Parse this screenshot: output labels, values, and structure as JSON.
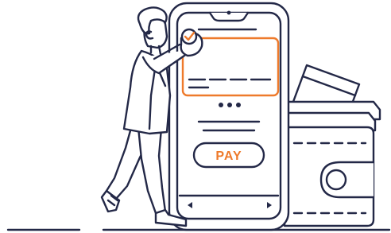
{
  "illustration": {
    "pay_button_label": "PAY",
    "icons": [
      "smartphone-icon",
      "wallet-icon",
      "credit-card-icon",
      "checkmark-icon",
      "person-icon"
    ],
    "colors": {
      "ink": "#232847",
      "accent": "#ee7a2b",
      "background": "#ffffff"
    }
  }
}
